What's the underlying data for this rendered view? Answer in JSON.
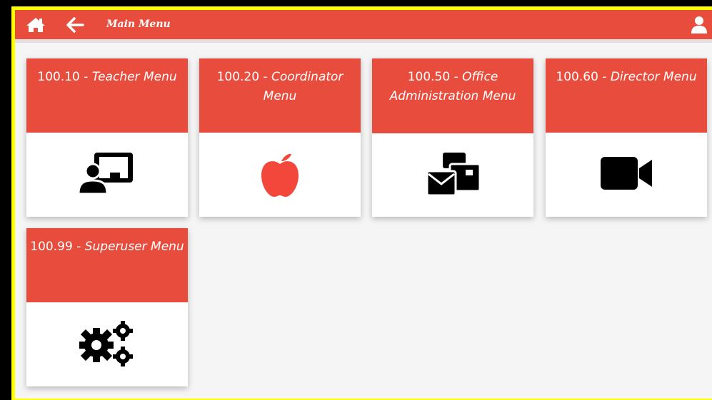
{
  "topbar": {
    "title": "Main Menu",
    "icons": {
      "home": "home-icon",
      "back": "arrow-left-icon",
      "user": "user-icon"
    }
  },
  "colors": {
    "accent": "#e84c3d",
    "border": "#ffff00",
    "background": "#f5f5f5"
  },
  "cards": [
    {
      "code": "100.10 - ",
      "label": "Teacher Menu",
      "icon": "chalkboard-teacher-icon"
    },
    {
      "code": "100.20 - ",
      "label": "Coordinator Menu",
      "icon": "apple-icon"
    },
    {
      "code": "100.50 - ",
      "label": "Office Administration Menu",
      "icon": "mail-bulk-icon"
    },
    {
      "code": "100.60 - ",
      "label": "Director Menu",
      "icon": "video-icon"
    },
    {
      "code": "100.99 - ",
      "label": "Superuser Menu",
      "icon": "cogs-icon"
    }
  ]
}
